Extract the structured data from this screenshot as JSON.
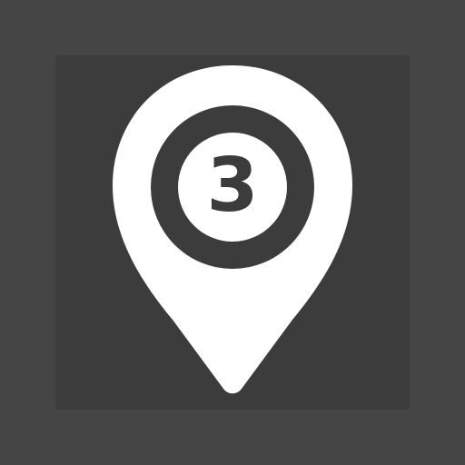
{
  "icon": {
    "name": "map-pin-number-icon",
    "number": "3"
  },
  "colors": {
    "background": "#454545",
    "tile": "#3c3c3c",
    "pin": "#ffffff",
    "ring": "#3c3c3c"
  }
}
